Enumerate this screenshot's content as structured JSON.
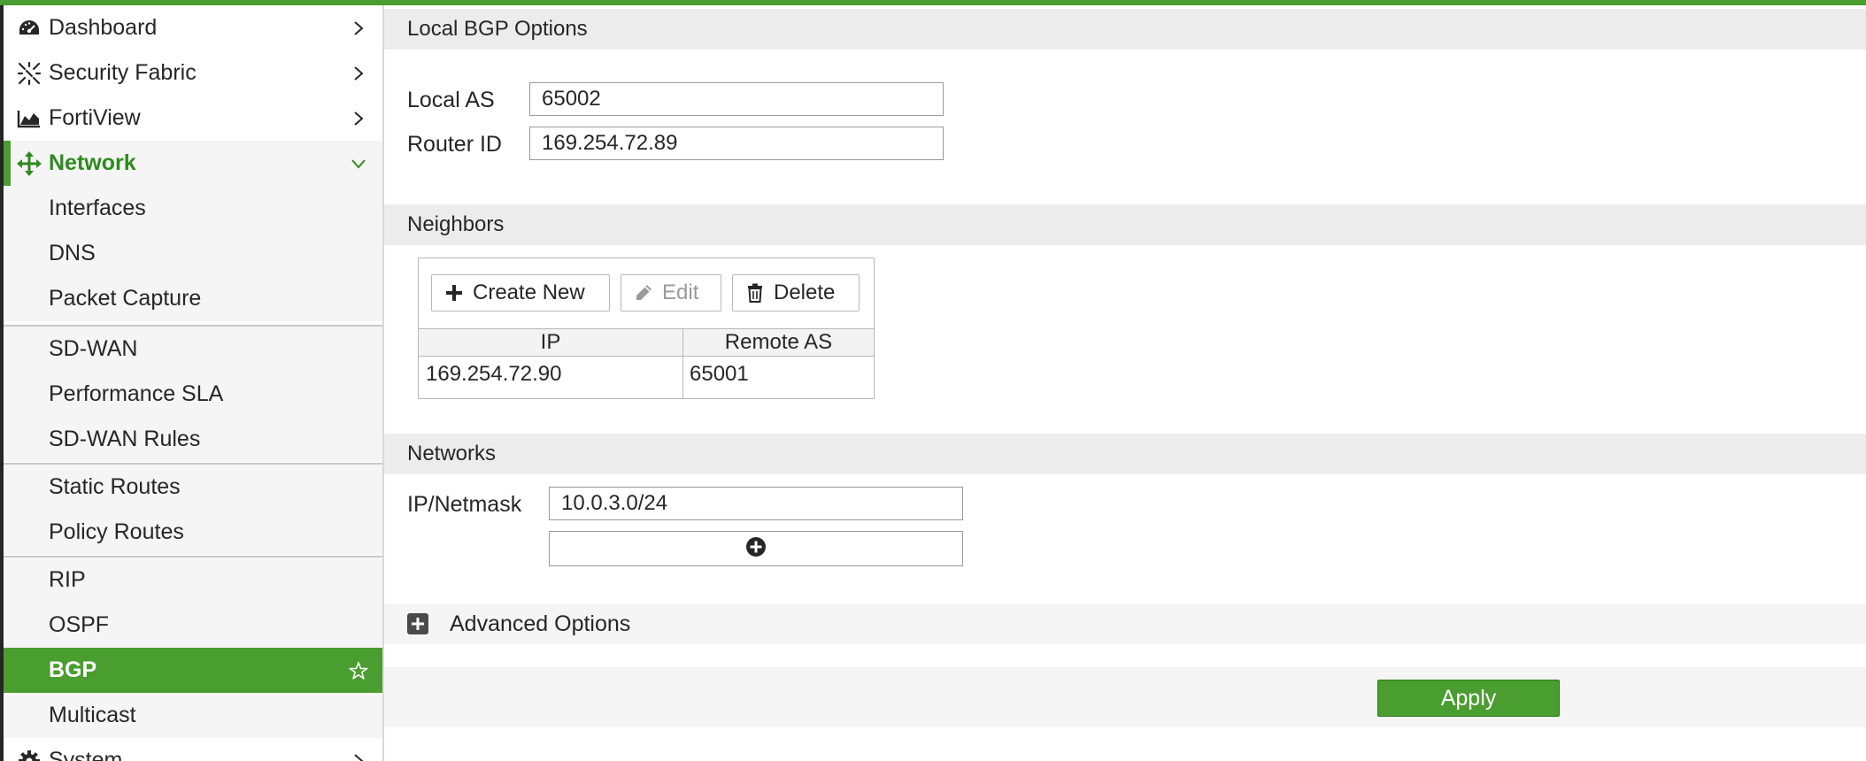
{
  "sidebar": {
    "items": [
      {
        "label": "Dashboard",
        "icon": "dashboard-gauge-icon"
      },
      {
        "label": "Security Fabric",
        "icon": "security-fabric-icon"
      },
      {
        "label": "FortiView",
        "icon": "fortiview-chart-icon"
      },
      {
        "label": "Network",
        "icon": "network-move-icon"
      },
      {
        "label": "Interfaces"
      },
      {
        "label": "DNS"
      },
      {
        "label": "Packet Capture"
      },
      {
        "label": "SD-WAN"
      },
      {
        "label": "Performance SLA"
      },
      {
        "label": "SD-WAN Rules"
      },
      {
        "label": "Static Routes"
      },
      {
        "label": "Policy Routes"
      },
      {
        "label": "RIP"
      },
      {
        "label": "OSPF"
      },
      {
        "label": "BGP"
      },
      {
        "label": "Multicast"
      },
      {
        "label": "System",
        "icon": "gear-icon"
      }
    ],
    "active": "BGP"
  },
  "local_bgp": {
    "title": "Local BGP Options",
    "local_as_label": "Local AS",
    "local_as_value": "65002",
    "router_id_label": "Router ID",
    "router_id_value": "169.254.72.89"
  },
  "neighbors": {
    "title": "Neighbors",
    "create_label": "Create New",
    "edit_label": "Edit",
    "delete_label": "Delete",
    "columns": [
      "IP",
      "Remote AS"
    ],
    "rows": [
      {
        "ip": "169.254.72.90",
        "remote_as": "65001"
      }
    ]
  },
  "networks": {
    "title": "Networks",
    "ip_netmask_label": "IP/Netmask",
    "ip_netmask_value": "10.0.3.0/24"
  },
  "advanced": {
    "label": "Advanced Options"
  },
  "footer": {
    "apply_label": "Apply"
  },
  "colors": {
    "accent": "#4a9d2f",
    "accent_text": "#2f8a1f",
    "section_bg": "#ececec"
  }
}
